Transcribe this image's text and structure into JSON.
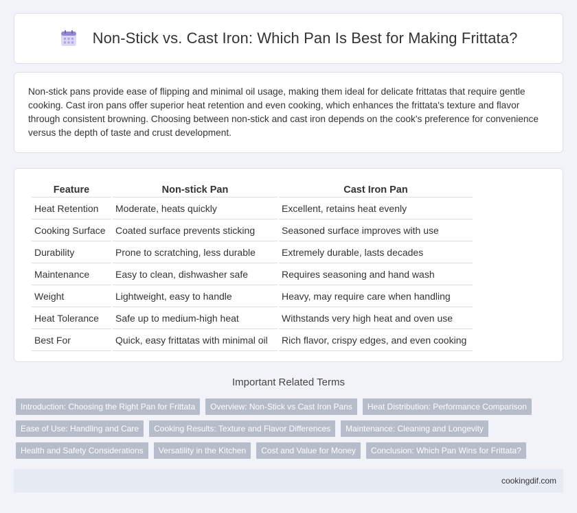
{
  "header": {
    "title": "Non-Stick vs. Cast Iron: Which Pan Is Best for Making Frittata?",
    "icon": "calendar-icon"
  },
  "intro": {
    "text": "Non-stick pans provide ease of flipping and minimal oil usage, making them ideal for delicate frittatas that require gentle cooking. Cast iron pans offer superior heat retention and even cooking, which enhances the frittata's texture and flavor through consistent browning. Choosing between non-stick and cast iron depends on the cook's preference for convenience versus the depth of taste and crust development."
  },
  "table": {
    "headers": [
      "Feature",
      "Non-stick Pan",
      "Cast Iron Pan"
    ],
    "rows": [
      [
        "Heat Retention",
        "Moderate, heats quickly",
        "Excellent, retains heat evenly"
      ],
      [
        "Cooking Surface",
        "Coated surface prevents sticking",
        "Seasoned surface improves with use"
      ],
      [
        "Durability",
        "Prone to scratching, less durable",
        "Extremely durable, lasts decades"
      ],
      [
        "Maintenance",
        "Easy to clean, dishwasher safe",
        "Requires seasoning and hand wash"
      ],
      [
        "Weight",
        "Lightweight, easy to handle",
        "Heavy, may require care when handling"
      ],
      [
        "Heat Tolerance",
        "Safe up to medium-high heat",
        "Withstands very high heat and oven use"
      ],
      [
        "Best For",
        "Quick, easy frittatas with minimal oil",
        "Rich flavor, crispy edges, and even cooking"
      ]
    ]
  },
  "related": {
    "title": "Important Related Terms",
    "tags": [
      [
        "Introduction: Choosing the Right Pan for Frittata",
        "Overview: Non-Stick vs Cast Iron Pans",
        "Heat Distribution: Performance Comparison"
      ],
      [
        "Ease of Use: Handling and Care",
        "Cooking Results: Texture and Flavor Differences",
        "Maintenance: Cleaning and Longevity"
      ],
      [
        "Health and Safety Considerations",
        "Versatility in the Kitchen",
        "Cost and Value for Money",
        "Conclusion: Which Pan Wins for Frittata?"
      ]
    ]
  },
  "footer": {
    "site": "cookingdif.com"
  },
  "colors": {
    "tag_bg": "#b6bcca",
    "page_bg": "#f1f3f8",
    "footer_bg": "#e6eaf3"
  }
}
